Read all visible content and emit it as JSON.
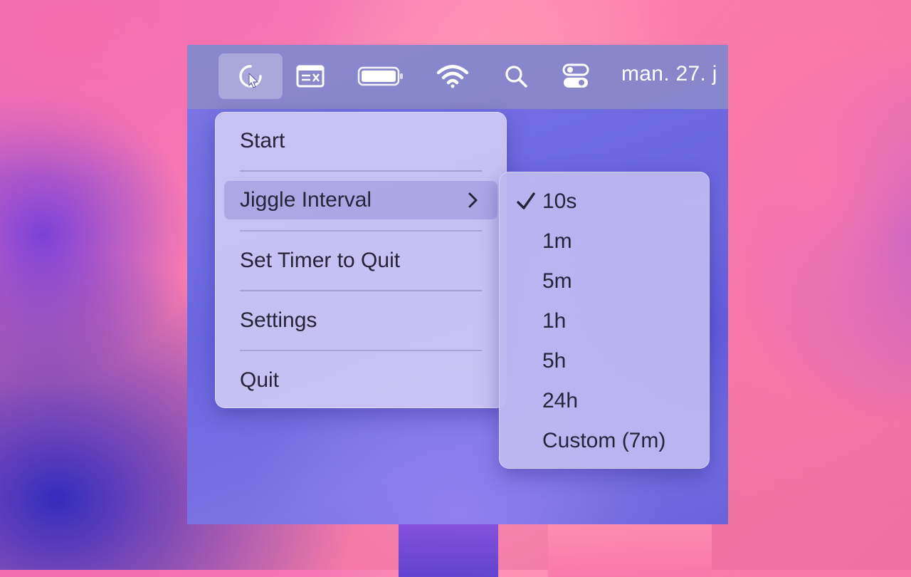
{
  "menubar": {
    "clock_text": "man. 27. j",
    "icons": [
      "jiggler-cursor-icon",
      "screen-capture-icon",
      "battery-icon",
      "wifi-icon",
      "search-icon",
      "control-center-icon"
    ]
  },
  "menu": {
    "items": [
      {
        "label": "Start"
      },
      {
        "label": "Jiggle Interval",
        "highlighted": true,
        "has_submenu": true
      },
      {
        "label": "Set Timer to Quit"
      },
      {
        "label": "Settings"
      },
      {
        "label": "Quit"
      }
    ]
  },
  "submenu": {
    "selected": "10s",
    "items": [
      {
        "label": "10s",
        "checked": true
      },
      {
        "label": "1m"
      },
      {
        "label": "5m"
      },
      {
        "label": "1h"
      },
      {
        "label": "5h"
      },
      {
        "label": "24h"
      },
      {
        "label": "Custom (7m)"
      }
    ]
  },
  "colors": {
    "menu_bg": "#cec8f4",
    "highlight": "#a098dc",
    "text": "#27233a"
  }
}
